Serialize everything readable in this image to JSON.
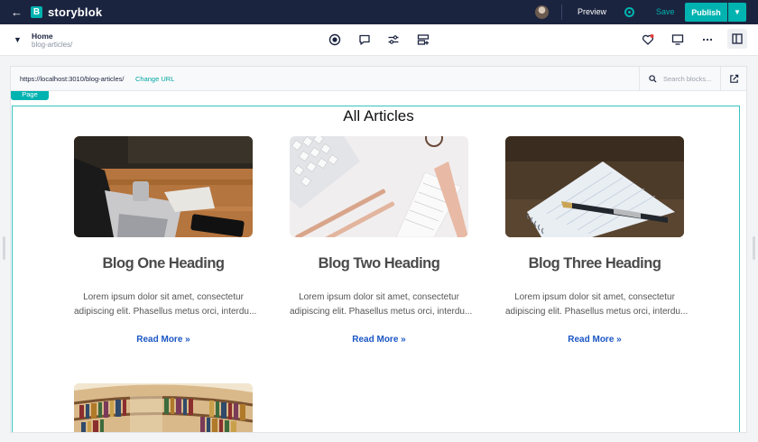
{
  "app": {
    "logo_letter": "B",
    "name": "storyblok",
    "preview_label": "Preview",
    "save_label": "Save",
    "publish_label": "Publish",
    "accent": "#00b3b0",
    "topbar_bg": "#1b243f"
  },
  "breadcrumb": {
    "title": "Home",
    "slug": "blog-articles/"
  },
  "toolbar": {
    "icons": [
      "record-icon",
      "comment-icon",
      "settings-sliders-icon",
      "layout-blocks-icon"
    ],
    "right_icons": [
      "heart-icon",
      "monitor-icon",
      "more-icon",
      "panel-toggle-icon"
    ]
  },
  "urlbar": {
    "url": "https://localhost:3010/blog-articles/",
    "change_url_label": "Change URL",
    "search_placeholder": "Search blocks..."
  },
  "canvas": {
    "page_tag": "Page",
    "heading": "All Articles",
    "cards": [
      {
        "title": "Blog One Heading",
        "text_line1": "Lorem ipsum dolor sit amet, consectetur",
        "text_line2": "adipiscing elit. Phasellus metus orci, interdu...",
        "link": "Read More »"
      },
      {
        "title": "Blog Two Heading",
        "text_line1": "Lorem ipsum dolor sit amet, consectetur",
        "text_line2": "adipiscing elit. Phasellus metus orci, interdu...",
        "link": "Read More »"
      },
      {
        "title": "Blog Three Heading",
        "text_line1": "Lorem ipsum dolor sit amet, consectetur",
        "text_line2": "adipiscing elit. Phasellus metus orci, interdu...",
        "link": "Read More »"
      }
    ]
  }
}
